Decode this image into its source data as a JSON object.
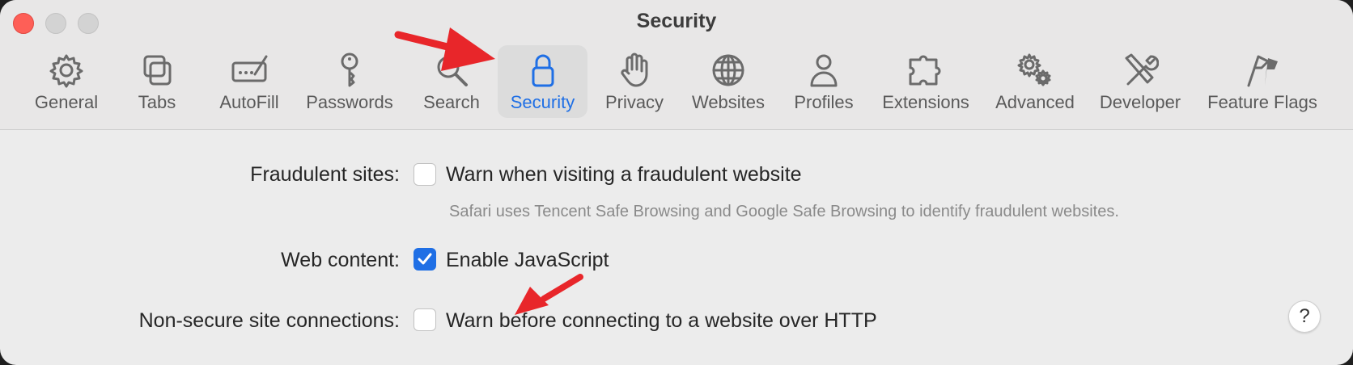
{
  "window": {
    "title": "Security"
  },
  "tabs": [
    {
      "label": "General",
      "icon": "gear-icon"
    },
    {
      "label": "Tabs",
      "icon": "tabs-icon"
    },
    {
      "label": "AutoFill",
      "icon": "autofill-icon"
    },
    {
      "label": "Passwords",
      "icon": "key-icon"
    },
    {
      "label": "Search",
      "icon": "magnifier-icon"
    },
    {
      "label": "Security",
      "icon": "lock-icon",
      "active": true
    },
    {
      "label": "Privacy",
      "icon": "hand-icon"
    },
    {
      "label": "Websites",
      "icon": "globe-icon"
    },
    {
      "label": "Profiles",
      "icon": "person-icon"
    },
    {
      "label": "Extensions",
      "icon": "puzzle-icon"
    },
    {
      "label": "Advanced",
      "icon": "gears-icon"
    },
    {
      "label": "Developer",
      "icon": "tools-icon"
    },
    {
      "label": "Feature Flags",
      "icon": "flags-icon"
    }
  ],
  "settings": {
    "fraudulent": {
      "label": "Fraudulent sites:",
      "option": "Warn when visiting a fraudulent website",
      "checked": false,
      "hint": "Safari uses Tencent Safe Browsing and Google Safe Browsing to identify fraudulent websites."
    },
    "web_content": {
      "label": "Web content:",
      "option": "Enable JavaScript",
      "checked": true
    },
    "non_secure": {
      "label": "Non-secure site connections:",
      "option": "Warn before connecting to a website over HTTP",
      "checked": false
    }
  },
  "help": {
    "label": "?"
  },
  "colors": {
    "accent": "#1f6fe5",
    "annotation_arrow": "#e8262a"
  }
}
